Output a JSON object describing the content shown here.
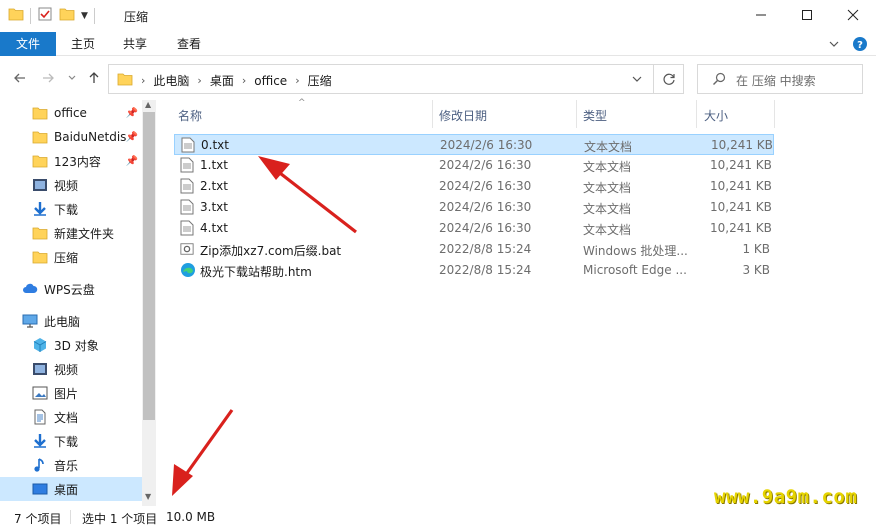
{
  "window": {
    "title": "压缩",
    "controls": [
      "minimize",
      "maximize",
      "close"
    ]
  },
  "ribbon": {
    "tabs": [
      "文件",
      "主页",
      "共享",
      "查看"
    ]
  },
  "address": {
    "crumbs": [
      "此电脑",
      "桌面",
      "office",
      "压缩"
    ],
    "search_placeholder": "在 压缩 中搜索"
  },
  "sidebar": {
    "items": [
      {
        "label": "office",
        "icon": "folder-icon",
        "pinned": true
      },
      {
        "label": "BaiduNetdis",
        "icon": "folder-icon",
        "pinned": true
      },
      {
        "label": "123内容",
        "icon": "folder-icon",
        "pinned": true
      },
      {
        "label": "视频",
        "icon": "video-icon",
        "pinned": false
      },
      {
        "label": "下载",
        "icon": "download-icon",
        "pinned": false
      },
      {
        "label": "新建文件夹",
        "icon": "folder-icon",
        "pinned": false
      },
      {
        "label": "压缩",
        "icon": "folder-icon",
        "pinned": false
      },
      {
        "label": "WPS云盘",
        "icon": "cloud-icon",
        "pinned": false
      },
      {
        "label": "此电脑",
        "icon": "computer-icon",
        "pinned": false
      },
      {
        "label": "3D 对象",
        "icon": "cube-icon",
        "pinned": false
      },
      {
        "label": "视频",
        "icon": "video-icon",
        "pinned": false
      },
      {
        "label": "图片",
        "icon": "picture-icon",
        "pinned": false
      },
      {
        "label": "文档",
        "icon": "document-icon",
        "pinned": false
      },
      {
        "label": "下载",
        "icon": "download-icon",
        "pinned": false
      },
      {
        "label": "音乐",
        "icon": "music-icon",
        "pinned": false
      },
      {
        "label": "桌面",
        "icon": "desktop-icon",
        "pinned": false,
        "selected": true
      }
    ]
  },
  "columns": {
    "name": "名称",
    "date": "修改日期",
    "type": "类型",
    "size": "大小"
  },
  "files": [
    {
      "name": "0.txt",
      "date": "2024/2/6 16:30",
      "type": "文本文档",
      "size": "10,241 KB",
      "icon": "text-file-icon",
      "selected": true
    },
    {
      "name": "1.txt",
      "date": "2024/2/6 16:30",
      "type": "文本文档",
      "size": "10,241 KB",
      "icon": "text-file-icon"
    },
    {
      "name": "2.txt",
      "date": "2024/2/6 16:30",
      "type": "文本文档",
      "size": "10,241 KB",
      "icon": "text-file-icon"
    },
    {
      "name": "3.txt",
      "date": "2024/2/6 16:30",
      "type": "文本文档",
      "size": "10,241 KB",
      "icon": "text-file-icon"
    },
    {
      "name": "4.txt",
      "date": "2024/2/6 16:30",
      "type": "文本文档",
      "size": "10,241 KB",
      "icon": "text-file-icon"
    },
    {
      "name": "Zip添加xz7.com后缀.bat",
      "date": "2022/8/8 15:24",
      "type": "Windows 批处理...",
      "size": "1 KB",
      "icon": "batch-file-icon"
    },
    {
      "name": "极光下载站帮助.htm",
      "date": "2022/8/8 15:24",
      "type": "Microsoft Edge ...",
      "size": "3 KB",
      "icon": "edge-icon"
    }
  ],
  "status": {
    "count": "7 个项目",
    "selected": "选中 1 个项目",
    "size": "10.0 MB"
  },
  "watermark": "www.9a9m.com",
  "colors": {
    "accent": "#1979ca",
    "selection": "#cce8ff",
    "selection_border": "#99d1ff",
    "folder": "#ffd35a",
    "arrow": "#d9211d"
  }
}
